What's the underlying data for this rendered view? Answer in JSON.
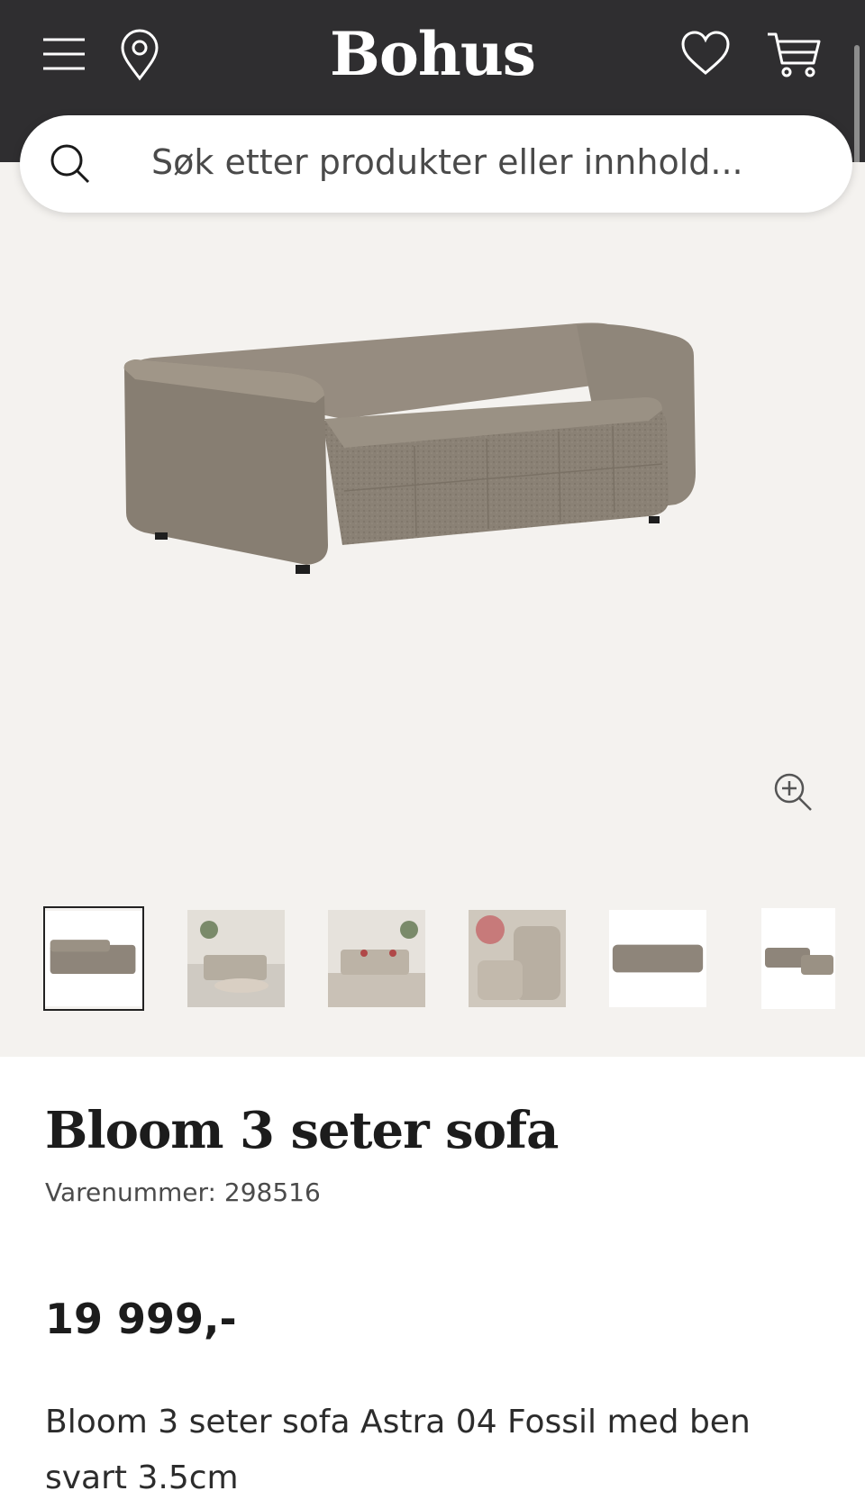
{
  "header": {
    "logo": "Bohus",
    "menu_icon": "menu-icon",
    "location_icon": "location-pin-icon",
    "wishlist_icon": "heart-icon",
    "cart_icon": "cart-icon",
    "background_color": "#2f2e30"
  },
  "search": {
    "placeholder": "Søk etter produkter eller innhold...",
    "icon": "search-icon"
  },
  "gallery": {
    "zoom_icon": "zoom-in-icon",
    "thumbnails": [
      {
        "kind": "sofa-product",
        "selected": true
      },
      {
        "kind": "living-room-scene",
        "selected": false
      },
      {
        "kind": "living-room-scene",
        "selected": false
      },
      {
        "kind": "detail-closeup",
        "selected": false
      },
      {
        "kind": "sofa-product",
        "selected": false
      },
      {
        "kind": "sofa-with-ottoman",
        "selected": false
      }
    ],
    "background_color": "#f4f2ef"
  },
  "product": {
    "title": "Bloom 3 seter sofa",
    "sku": "Varenummer: 298516",
    "price": "19 999,-",
    "description": "Bloom 3 seter sofa Astra 04 Fossil med ben svart 3.5cm"
  }
}
